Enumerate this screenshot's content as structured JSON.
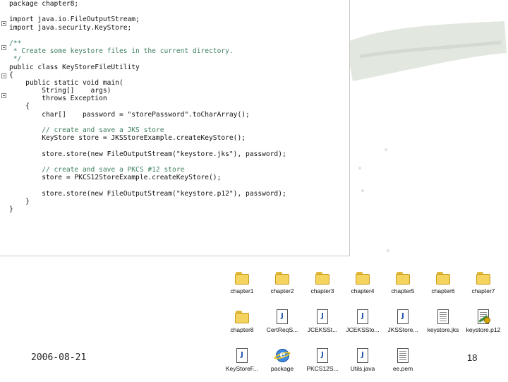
{
  "editor": {
    "lines": [
      "package chapter8;",
      "",
      "import java.io.FileOutputStream;",
      "import java.security.KeyStore;",
      "",
      "/**",
      " * Create some keystore files in the current directory.",
      " */",
      "public class KeyStoreFileUtility",
      "{",
      "    public static void main(",
      "        String[]    args)",
      "        throws Exception",
      "    {",
      "        char[]    password = \"storePassword\".toCharArray();",
      "",
      "        // create and save a JKS store",
      "        KeyStore store = JKSStoreExample.createKeyStore();",
      "",
      "        store.store(new FileOutputStream(\"keystore.jks\"), password);",
      "",
      "        // create and save a PKCS #12 store",
      "        store = PKCS12StoreExample.createKeyStore();",
      "",
      "        store.store(new FileOutputStream(\"keystore.p12\"), password);",
      "    }",
      "}"
    ]
  },
  "explorer": {
    "items": [
      {
        "label": "chapter1",
        "icon": "folder-icon"
      },
      {
        "label": "chapter2",
        "icon": "folder-icon"
      },
      {
        "label": "chapter3",
        "icon": "folder-icon"
      },
      {
        "label": "chapter4",
        "icon": "folder-icon"
      },
      {
        "label": "chapter5",
        "icon": "folder-icon"
      },
      {
        "label": "chapter6",
        "icon": "folder-icon"
      },
      {
        "label": "chapter7",
        "icon": "folder-icon"
      },
      {
        "label": "chapter8",
        "icon": "folder-icon"
      },
      {
        "label": "CertReqS...",
        "icon": "java-file-icon"
      },
      {
        "label": "JCEKSSt...",
        "icon": "java-file-icon"
      },
      {
        "label": "JCEKSSto...",
        "icon": "java-file-icon"
      },
      {
        "label": "JKSStore...",
        "icon": "java-file-icon"
      },
      {
        "label": "keystore.jks",
        "icon": "document-icon"
      },
      {
        "label": "keystore.p12",
        "icon": "certificate-icon"
      },
      {
        "label": "KeyStoreF...",
        "icon": "java-file-icon"
      },
      {
        "label": "package",
        "icon": "internet-explorer-icon"
      },
      {
        "label": "PKCS12S...",
        "icon": "java-file-icon"
      },
      {
        "label": "Utils.java",
        "icon": "java-file-icon"
      },
      {
        "label": "ee.pem",
        "icon": "document-icon"
      }
    ]
  },
  "footer": {
    "date": "2006-08-21",
    "slide_number": "18"
  },
  "colors": {
    "comment": "#3f7f5f",
    "folder": "#f4d35e",
    "background_decoration": "#dfe6dc"
  }
}
